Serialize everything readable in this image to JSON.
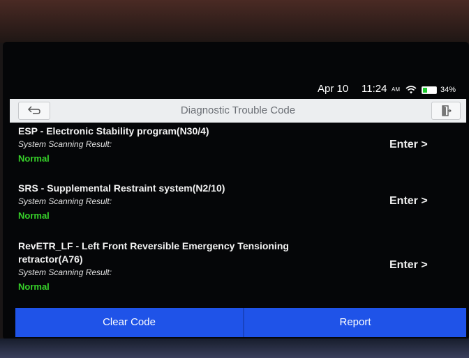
{
  "status": {
    "date": "Apr 10",
    "time": "11:24",
    "ampm": "AM",
    "battery_percent": "34%",
    "battery_level": 0.34,
    "wifi_icon": "wifi-icon",
    "battery_icon": "battery-icon"
  },
  "header": {
    "title": "Diagnostic Trouble Code",
    "back_icon": "back-arrow-icon",
    "exit_icon": "exit-icon"
  },
  "items": [
    {
      "title": "ESP - Electronic Stability program(N30/4)",
      "sub": "System Scanning Result:",
      "status": "Normal",
      "enter": "Enter >"
    },
    {
      "title": "SRS - Supplemental Restraint system(N2/10)",
      "sub": "System Scanning Result:",
      "status": "Normal",
      "enter": "Enter >"
    },
    {
      "title": "RevETR_LF - Left Front Reversible Emergency Tensioning retractor(A76)",
      "sub": "System Scanning Result:",
      "status": "Normal",
      "enter": "Enter >"
    }
  ],
  "footer": {
    "clear_label": "Clear Code",
    "report_label": "Report"
  },
  "colors": {
    "accent_blue": "#1f53e8",
    "status_green": "#37d22a"
  }
}
